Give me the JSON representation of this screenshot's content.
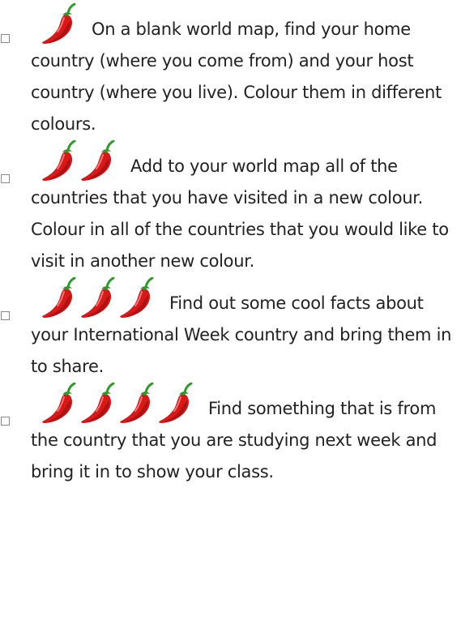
{
  "tasks": [
    {
      "chili_count": 1,
      "icon": "chili-pepper-icon",
      "text": "On a blank world map, find your home country (where you come from) and your host country (where you live). Colour them in different colours."
    },
    {
      "chili_count": 2,
      "icon": "chili-pepper-icon",
      "text": "Add to your world map all of the countries that you have visited in a new colour. Colour in all of the countries that you would like to visit in another new colour."
    },
    {
      "chili_count": 3,
      "icon": "chili-pepper-icon",
      "text": "Find out some cool facts about your International Week country and bring them in to share."
    },
    {
      "chili_count": 4,
      "icon": "chili-pepper-icon",
      "text": "Find something that is from the country that you are studying next week and bring it in to show your class."
    }
  ],
  "colors": {
    "chili_red": "#d7191a",
    "chili_dark": "#8a0d10",
    "stem_green": "#2f9a2a",
    "text": "#222222",
    "checkbox_border": "#8a8a8a"
  }
}
